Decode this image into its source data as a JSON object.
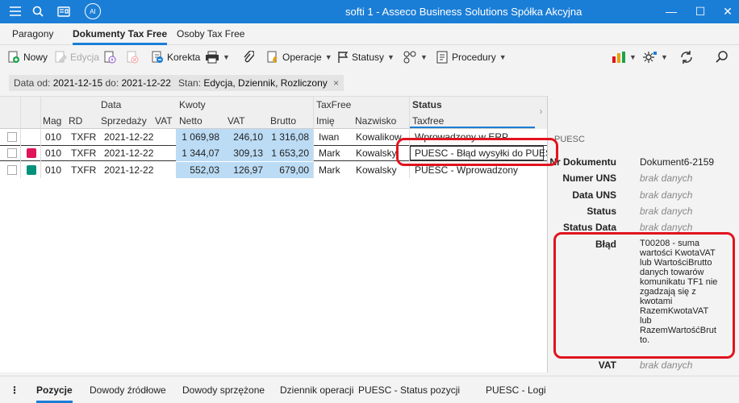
{
  "titlebar": {
    "title": "softi 1 - Asseco Business Solutions Spółka Akcyjna",
    "ai_label": "AI"
  },
  "tabs": [
    {
      "label": "Paragony"
    },
    {
      "label": "Dokumenty Tax Free"
    },
    {
      "label": "Osoby Tax Free"
    }
  ],
  "toolbar": {
    "nowy": "Nowy",
    "edycja": "Edycja",
    "korekta": "Korekta",
    "operacje": "Operacje",
    "statusy": "Statusy",
    "procedury": "Procedury"
  },
  "filters": {
    "data_label": "Data",
    "od_label": "od:",
    "od_value": "2021-12-15",
    "do_label": "do:",
    "do_value": "2021-12-22",
    "stan_label": "Stan:",
    "stan_value": "Edycja, Dziennik, Rozliczony",
    "clear_icon": "×"
  },
  "grid": {
    "group_headers": {
      "data": "Data",
      "kwoty": "Kwoty",
      "taxfree": "TaxFree",
      "status": "Status"
    },
    "columns": {
      "mag": "Mag",
      "rd": "RD",
      "sprzedazy": "Sprzedaży",
      "vat": "VAT",
      "netto": "Netto",
      "kvat": "VAT",
      "brutto": "Brutto",
      "imie": "Imię",
      "nazwisko": "Nazwisko",
      "taxfree": "Taxfree"
    },
    "rows": [
      {
        "color": "",
        "mag": "010",
        "rd": "TXFR",
        "data": "2021-12-22",
        "vat": "",
        "netto": "1 069,98",
        "kvat": "246,10",
        "brutto": "1 316,08",
        "imie": "Iwan",
        "nazwisko": "Kowalikow",
        "status": "Wprowadzony w ERP"
      },
      {
        "color": "#e0145a",
        "mag": "010",
        "rd": "TXFR",
        "data": "2021-12-22",
        "vat": "",
        "netto": "1 344,07",
        "kvat": "309,13",
        "brutto": "1 653,20",
        "imie": "Mark",
        "nazwisko": "Kowalsky",
        "status": "PUESC - Błąd wysyłki do PUESC"
      },
      {
        "color": "#00927a",
        "mag": "010",
        "rd": "TXFR",
        "data": "2021-12-22",
        "vat": "",
        "netto": "552,03",
        "kvat": "126,97",
        "brutto": "679,00",
        "imie": "Mark",
        "nazwisko": "Kowalsky",
        "status": "PUESC - Wprowadzony"
      }
    ]
  },
  "panel": {
    "title": "PUESC",
    "fields": [
      {
        "label": "Nr Dokumentu",
        "value": "Dokument6-2159",
        "nodata": false
      },
      {
        "label": "Numer UNS",
        "value": "brak danych",
        "nodata": true
      },
      {
        "label": "Data UNS",
        "value": "brak danych",
        "nodata": true
      },
      {
        "label": "Status",
        "value": "brak danych",
        "nodata": true
      },
      {
        "label": "Status Data",
        "value": "brak danych",
        "nodata": true
      }
    ],
    "blad_label": "Błąd",
    "blad_lines": [
      "T00208 - suma",
      "wartości KwotaVAT",
      "lub WartościBrutto",
      "danych towarów",
      "komunikatu TF1 nie",
      "zgadzają się z",
      "kwotami",
      "RazemKwotaVAT",
      "lub",
      "RazemWartośćBrut",
      "to."
    ],
    "vat_label": "VAT",
    "vat_value": "brak danych"
  },
  "bottom_tabs": [
    {
      "label": "Pozycje"
    },
    {
      "label": "Dowody źródłowe"
    },
    {
      "label": "Dowody sprzężone"
    },
    {
      "label": "Dziennik operacji"
    },
    {
      "label": "PUESC - Status pozycji"
    },
    {
      "label": "PUESC - Logi"
    }
  ],
  "colors": {
    "accent": "#1b7ed6",
    "highlight": "#e0141e",
    "kwoty_bg": "#bcdcf5"
  }
}
